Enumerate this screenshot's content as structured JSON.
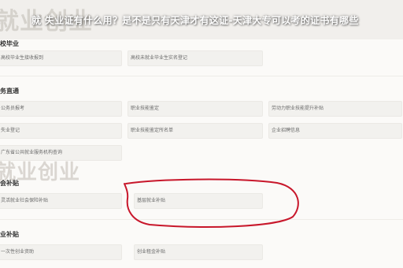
{
  "headline": "就 失业证有什么用？是不是只有天津才有这证-天津大专可以考的证书有哪些",
  "watermark_top": "就业创业",
  "watermark_bottom": "就业创业",
  "sections": {
    "graduates": {
      "title": "校毕业",
      "items": [
        "高校毕业生接收报到",
        "高校未就业毕业生实名登记"
      ]
    },
    "express": {
      "title": "务直通",
      "items": [
        "公务员报考",
        "职业技能鉴定",
        "劳动力职业技能提升补贴",
        "失业登记",
        "职业技能鉴定所名单",
        "企业招聘信息",
        "广东省公共就业服务机构查询"
      ]
    },
    "subsidy": {
      "title": "会补贴",
      "items": [
        "灵活就业社会保险补贴",
        "基层就业补贴"
      ]
    },
    "startup": {
      "title": "业补贴",
      "items": [
        "一次性创业资助",
        "创业租金补贴"
      ]
    }
  },
  "colors": {
    "annotation": "#c8172b",
    "card_bg": "#f2f1ee",
    "page_bg": "#fbfaf8"
  }
}
